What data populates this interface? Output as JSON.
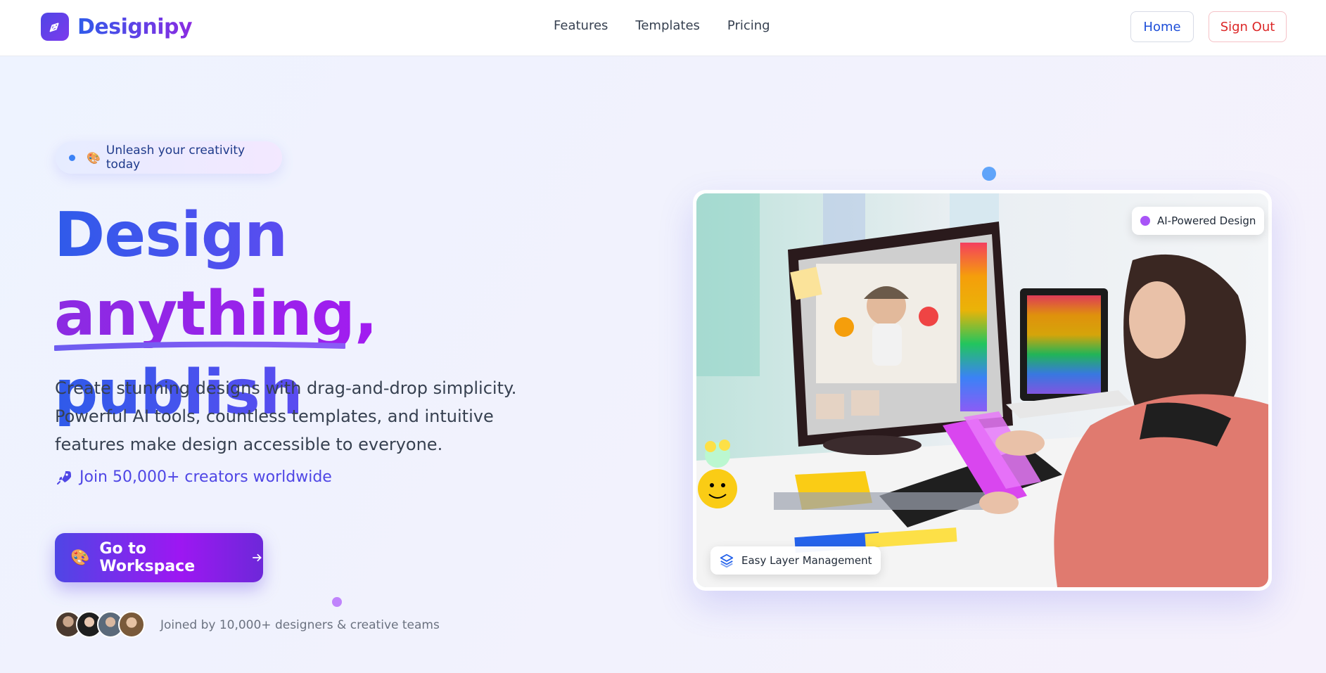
{
  "header": {
    "brand": "Designipy",
    "nav": [
      {
        "label": "Features"
      },
      {
        "label": "Templates"
      },
      {
        "label": "Pricing"
      }
    ],
    "home_label": "Home",
    "signout_label": "Sign Out"
  },
  "hero": {
    "pill_icon": "palette-icon",
    "pill_text": "Unleash your creativity today",
    "headline_part1": "Design ",
    "headline_part2": "anything,",
    "headline_part3": "publish",
    "description": "Create stunning designs with drag-and-drop simplicity. Powerful AI tools, countless templates, and intuitive features make design accessible to everyone.",
    "join_icon": "rocket-icon",
    "join_text": "Join 50,000+ creators worldwide",
    "cta_label": "Go to Workspace",
    "joined_text": "Joined by 10,000+ designers & creative teams"
  },
  "image_card": {
    "ai_badge": "AI-Powered Design",
    "layer_badge": "Easy Layer Management"
  },
  "colors": {
    "brand_blue": "#2f5bea",
    "brand_purple": "#8b2be2",
    "signout_red": "#dc2626"
  }
}
